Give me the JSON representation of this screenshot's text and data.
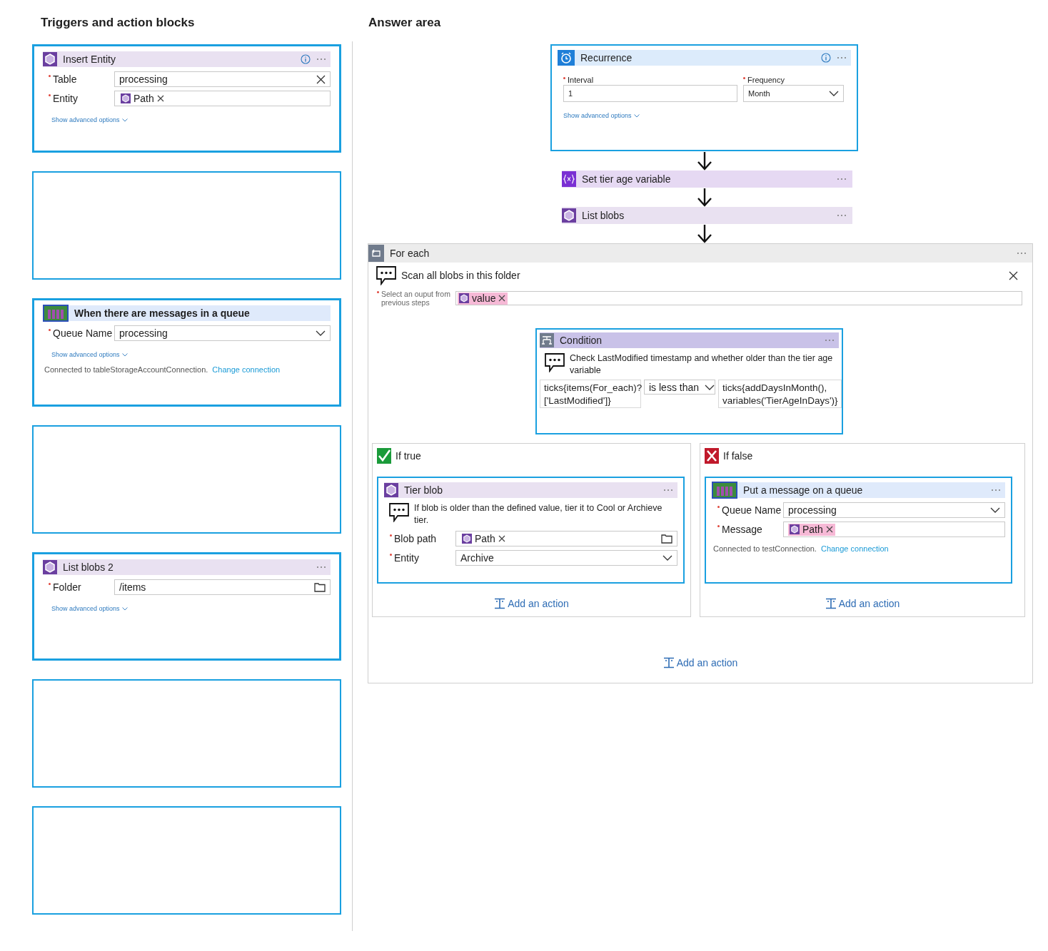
{
  "left_panel": {
    "title": "Triggers and action blocks",
    "slots": [
      {
        "kind": "action",
        "block": {
          "title": "Insert Entity",
          "kind": "storage",
          "info": true,
          "menu": true,
          "fields": [
            {
              "label": "Table",
              "required": true,
              "value": "processing",
              "kind": "clear"
            },
            {
              "label": "Entity",
              "required": true,
              "token": {
                "label": "Path",
                "highlight": false
              }
            }
          ],
          "advanced": "Show advanced options"
        }
      },
      {
        "kind": "empty"
      },
      {
        "kind": "action",
        "block": {
          "title": "When there are messages in a queue",
          "kind": "queue",
          "trigger": true,
          "fields": [
            {
              "label": "Queue Name",
              "required": true,
              "value": "processing",
              "kind": "dropdown"
            }
          ],
          "advanced": "Show advanced options",
          "connection": {
            "text": "Connected to tableStorageAccountConnection.",
            "link": "Change connection"
          }
        }
      },
      {
        "kind": "empty"
      },
      {
        "kind": "action",
        "block": {
          "title": "List blobs 2",
          "kind": "storage",
          "menu": true,
          "fields": [
            {
              "label": "Folder",
              "required": true,
              "value": "/items",
              "kind": "folder"
            }
          ],
          "advanced": "Show advanced options"
        }
      },
      {
        "kind": "empty"
      },
      {
        "kind": "empty"
      }
    ]
  },
  "answer_area": {
    "title": "Answer area",
    "recurrence": {
      "title": "Recurrence",
      "kind": "clock",
      "info": true,
      "menu": true,
      "fields": [
        {
          "label": "Interval",
          "required": true,
          "value": "1"
        },
        {
          "label": "Frequency",
          "required": true,
          "value": "Month",
          "kind": "dropdown"
        }
      ],
      "advanced": "Show advanced options"
    },
    "steps": [
      {
        "title": "Set tier age variable",
        "kind": "variable"
      },
      {
        "title": "List blobs",
        "kind": "storage"
      }
    ],
    "for_each": {
      "title": "For each",
      "comment": "Scan all blobs in this folder",
      "output": {
        "label": "Select an ouput from previous steps",
        "required": true,
        "token": {
          "label": "value",
          "highlight": true
        }
      },
      "condition": {
        "title": "Condition",
        "comment": "Check LastModified timestamp and whether older than the tier age variable",
        "left": [
          "ticks{items(For_each)?",
          "['LastModified']}"
        ],
        "operator": "is less than",
        "right": [
          "ticks{addDaysInMonth(),",
          "variables('TierAgeInDays')}"
        ]
      },
      "branches": [
        {
          "kind": "true",
          "label": "If true",
          "block": {
            "title": "Tier blob",
            "kind": "storage",
            "menu": true,
            "comment": "If blob is older than the defined value, tier it to Cool or Archieve tier.",
            "fields": [
              {
                "label": "Blob path",
                "required": true,
                "token": {
                  "label": "Path",
                  "highlight": false
                },
                "kind": "folder"
              },
              {
                "label": "Entity",
                "required": true,
                "value": "Archive",
                "kind": "dropdown"
              }
            ]
          },
          "add_action": "Add an action"
        },
        {
          "kind": "false",
          "label": "If false",
          "block": {
            "title": "Put a message on a queue",
            "kind": "queue",
            "menu": true,
            "fields": [
              {
                "label": "Queue Name",
                "required": true,
                "value": "processing",
                "kind": "dropdown"
              },
              {
                "label": "Message",
                "required": true,
                "token": {
                  "label": "Path",
                  "highlight": true
                }
              }
            ],
            "connection": {
              "text": "Connected to testConnection.",
              "link": "Change connection"
            }
          },
          "add_action": "Add an action"
        }
      ],
      "add_action": "Add an action"
    }
  }
}
